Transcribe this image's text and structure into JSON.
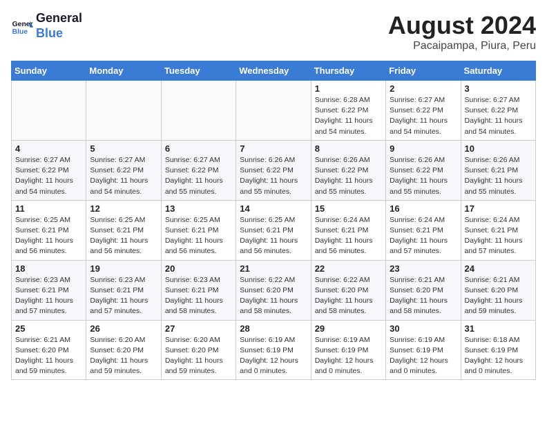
{
  "header": {
    "logo_line1": "General",
    "logo_line2": "Blue",
    "month_title": "August 2024",
    "location": "Pacaipampa, Piura, Peru"
  },
  "days_of_week": [
    "Sunday",
    "Monday",
    "Tuesday",
    "Wednesday",
    "Thursday",
    "Friday",
    "Saturday"
  ],
  "weeks": [
    [
      {
        "day": "",
        "info": ""
      },
      {
        "day": "",
        "info": ""
      },
      {
        "day": "",
        "info": ""
      },
      {
        "day": "",
        "info": ""
      },
      {
        "day": "1",
        "info": "Sunrise: 6:28 AM\nSunset: 6:22 PM\nDaylight: 11 hours\nand 54 minutes."
      },
      {
        "day": "2",
        "info": "Sunrise: 6:27 AM\nSunset: 6:22 PM\nDaylight: 11 hours\nand 54 minutes."
      },
      {
        "day": "3",
        "info": "Sunrise: 6:27 AM\nSunset: 6:22 PM\nDaylight: 11 hours\nand 54 minutes."
      }
    ],
    [
      {
        "day": "4",
        "info": "Sunrise: 6:27 AM\nSunset: 6:22 PM\nDaylight: 11 hours\nand 54 minutes."
      },
      {
        "day": "5",
        "info": "Sunrise: 6:27 AM\nSunset: 6:22 PM\nDaylight: 11 hours\nand 54 minutes."
      },
      {
        "day": "6",
        "info": "Sunrise: 6:27 AM\nSunset: 6:22 PM\nDaylight: 11 hours\nand 55 minutes."
      },
      {
        "day": "7",
        "info": "Sunrise: 6:26 AM\nSunset: 6:22 PM\nDaylight: 11 hours\nand 55 minutes."
      },
      {
        "day": "8",
        "info": "Sunrise: 6:26 AM\nSunset: 6:22 PM\nDaylight: 11 hours\nand 55 minutes."
      },
      {
        "day": "9",
        "info": "Sunrise: 6:26 AM\nSunset: 6:22 PM\nDaylight: 11 hours\nand 55 minutes."
      },
      {
        "day": "10",
        "info": "Sunrise: 6:26 AM\nSunset: 6:21 PM\nDaylight: 11 hours\nand 55 minutes."
      }
    ],
    [
      {
        "day": "11",
        "info": "Sunrise: 6:25 AM\nSunset: 6:21 PM\nDaylight: 11 hours\nand 56 minutes."
      },
      {
        "day": "12",
        "info": "Sunrise: 6:25 AM\nSunset: 6:21 PM\nDaylight: 11 hours\nand 56 minutes."
      },
      {
        "day": "13",
        "info": "Sunrise: 6:25 AM\nSunset: 6:21 PM\nDaylight: 11 hours\nand 56 minutes."
      },
      {
        "day": "14",
        "info": "Sunrise: 6:25 AM\nSunset: 6:21 PM\nDaylight: 11 hours\nand 56 minutes."
      },
      {
        "day": "15",
        "info": "Sunrise: 6:24 AM\nSunset: 6:21 PM\nDaylight: 11 hours\nand 56 minutes."
      },
      {
        "day": "16",
        "info": "Sunrise: 6:24 AM\nSunset: 6:21 PM\nDaylight: 11 hours\nand 57 minutes."
      },
      {
        "day": "17",
        "info": "Sunrise: 6:24 AM\nSunset: 6:21 PM\nDaylight: 11 hours\nand 57 minutes."
      }
    ],
    [
      {
        "day": "18",
        "info": "Sunrise: 6:23 AM\nSunset: 6:21 PM\nDaylight: 11 hours\nand 57 minutes."
      },
      {
        "day": "19",
        "info": "Sunrise: 6:23 AM\nSunset: 6:21 PM\nDaylight: 11 hours\nand 57 minutes."
      },
      {
        "day": "20",
        "info": "Sunrise: 6:23 AM\nSunset: 6:21 PM\nDaylight: 11 hours\nand 58 minutes."
      },
      {
        "day": "21",
        "info": "Sunrise: 6:22 AM\nSunset: 6:20 PM\nDaylight: 11 hours\nand 58 minutes."
      },
      {
        "day": "22",
        "info": "Sunrise: 6:22 AM\nSunset: 6:20 PM\nDaylight: 11 hours\nand 58 minutes."
      },
      {
        "day": "23",
        "info": "Sunrise: 6:21 AM\nSunset: 6:20 PM\nDaylight: 11 hours\nand 58 minutes."
      },
      {
        "day": "24",
        "info": "Sunrise: 6:21 AM\nSunset: 6:20 PM\nDaylight: 11 hours\nand 59 minutes."
      }
    ],
    [
      {
        "day": "25",
        "info": "Sunrise: 6:21 AM\nSunset: 6:20 PM\nDaylight: 11 hours\nand 59 minutes."
      },
      {
        "day": "26",
        "info": "Sunrise: 6:20 AM\nSunset: 6:20 PM\nDaylight: 11 hours\nand 59 minutes."
      },
      {
        "day": "27",
        "info": "Sunrise: 6:20 AM\nSunset: 6:20 PM\nDaylight: 11 hours\nand 59 minutes."
      },
      {
        "day": "28",
        "info": "Sunrise: 6:19 AM\nSunset: 6:19 PM\nDaylight: 12 hours\nand 0 minutes."
      },
      {
        "day": "29",
        "info": "Sunrise: 6:19 AM\nSunset: 6:19 PM\nDaylight: 12 hours\nand 0 minutes."
      },
      {
        "day": "30",
        "info": "Sunrise: 6:19 AM\nSunset: 6:19 PM\nDaylight: 12 hours\nand 0 minutes."
      },
      {
        "day": "31",
        "info": "Sunrise: 6:18 AM\nSunset: 6:19 PM\nDaylight: 12 hours\nand 0 minutes."
      }
    ]
  ]
}
